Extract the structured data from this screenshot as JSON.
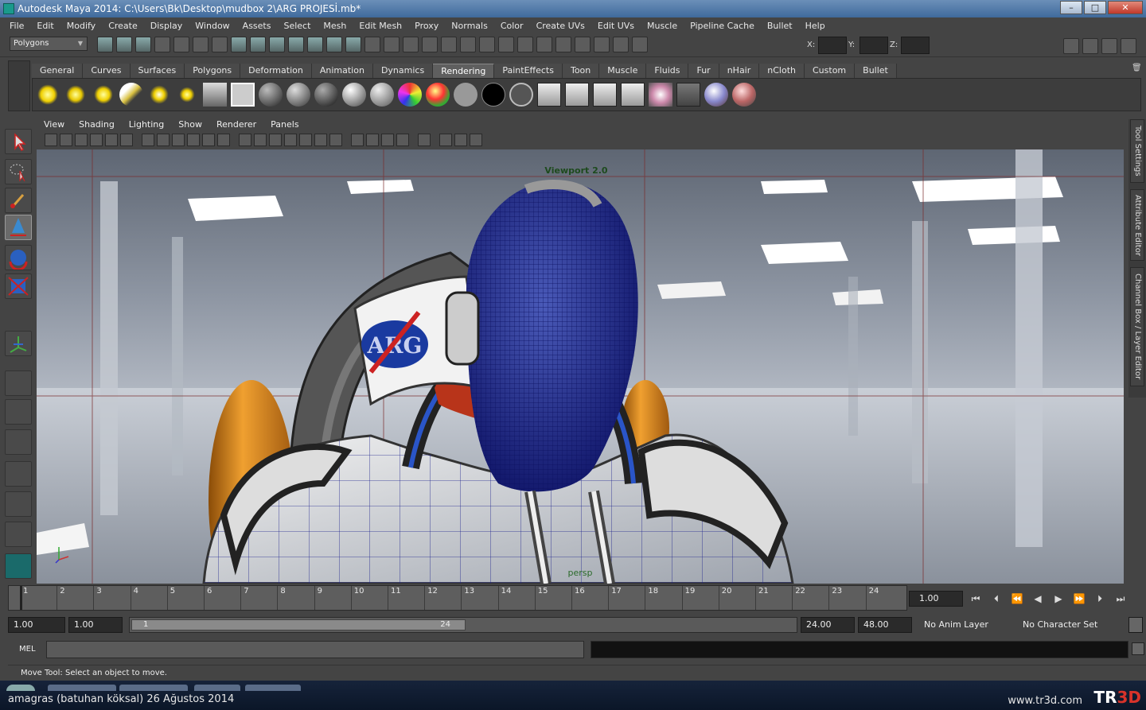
{
  "window": {
    "title": "Autodesk Maya 2014: C:\\Users\\Bk\\Desktop\\mudbox 2\\ARG PROJESİ.mb*",
    "minimize": "–",
    "maximize": "□",
    "close": "✕"
  },
  "menus": [
    "File",
    "Edit",
    "Modify",
    "Create",
    "Display",
    "Window",
    "Assets",
    "Select",
    "Mesh",
    "Edit Mesh",
    "Proxy",
    "Normals",
    "Color",
    "Create UVs",
    "Edit UVs",
    "Muscle",
    "Pipeline Cache",
    "Bullet",
    "Help"
  ],
  "status_line": {
    "menu_set": "Polygons",
    "x_label": "X:",
    "y_label": "Y:",
    "z_label": "Z:"
  },
  "shelf_tabs": [
    "General",
    "Curves",
    "Surfaces",
    "Polygons",
    "Deformation",
    "Animation",
    "Dynamics",
    "Rendering",
    "PaintEffects",
    "Toon",
    "Muscle",
    "Fluids",
    "Fur",
    "nHair",
    "nCloth",
    "Custom",
    "Bullet"
  ],
  "active_shelf": "Rendering",
  "viewport": {
    "menus": [
      "View",
      "Shading",
      "Lighting",
      "Show",
      "Renderer",
      "Panels"
    ],
    "label": "Viewport 2.0",
    "camera": "persp",
    "logo_text": "ARG"
  },
  "side_tabs": [
    "Tool Settings",
    "Attribute Editor",
    "Channel Box / Layer Editor"
  ],
  "timeline": {
    "ticks": [
      "1",
      "2",
      "3",
      "4",
      "5",
      "6",
      "7",
      "8",
      "9",
      "10",
      "11",
      "12",
      "13",
      "14",
      "15",
      "16",
      "17",
      "18",
      "19",
      "20",
      "21",
      "22",
      "23",
      "24"
    ],
    "current_frame": "1.00"
  },
  "range": {
    "start": "1.00",
    "start2": "1.00",
    "slider_start": "1",
    "slider_end": "24",
    "end": "24.00",
    "end2": "48.00",
    "anim_layer": "No Anim Layer",
    "char_set": "No Character Set"
  },
  "command_line": {
    "label": "MEL"
  },
  "help_line": "Move Tool: Select an object to move.",
  "credit": "amagras (batuhan köksal)  26 Ağustos 2014",
  "watermark": "www.tr3d.com",
  "watermark_logo": {
    "a": "TR",
    "b": "3D"
  },
  "colors": {
    "accent": "#3f6a9c",
    "wireframe": "#1a1f8c",
    "suit": "#d8d8d8",
    "tank": "#e08a1c"
  }
}
